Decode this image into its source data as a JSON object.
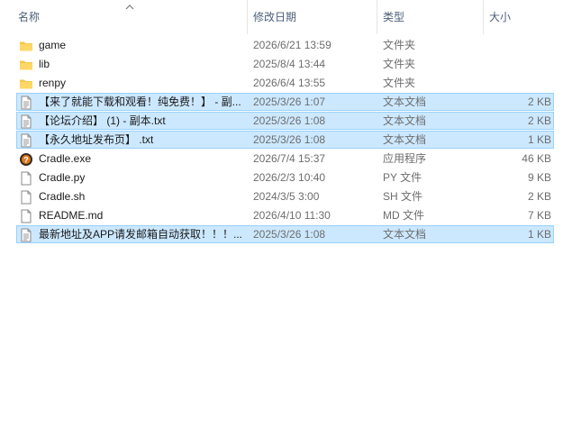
{
  "columns": {
    "name": "名称",
    "date": "修改日期",
    "type": "类型",
    "size": "大小"
  },
  "files": [
    {
      "name": "game",
      "date": "2026/6/21 13:59",
      "type": "文件夹",
      "size": "",
      "icon": "folder-icon",
      "selected": false
    },
    {
      "name": "lib",
      "date": "2025/8/4 13:44",
      "type": "文件夹",
      "size": "",
      "icon": "folder-icon",
      "selected": false
    },
    {
      "name": "renpy",
      "date": "2026/6/4 13:55",
      "type": "文件夹",
      "size": "",
      "icon": "folder-icon",
      "selected": false
    },
    {
      "name": "【来了就能下载和观看！纯免费！】 - 副...",
      "date": "2025/3/26 1:07",
      "type": "文本文档",
      "size": "2 KB",
      "icon": "text-document-icon",
      "selected": true
    },
    {
      "name": "【论坛介绍】 (1) - 副本.txt",
      "date": "2025/3/26 1:08",
      "type": "文本文档",
      "size": "2 KB",
      "icon": "text-document-icon",
      "selected": true
    },
    {
      "name": "【永久地址发布页】 .txt",
      "date": "2025/3/26 1:08",
      "type": "文本文档",
      "size": "1 KB",
      "icon": "text-document-icon",
      "selected": true
    },
    {
      "name": "Cradle.exe",
      "date": "2026/7/4 15:37",
      "type": "应用程序",
      "size": "46 KB",
      "icon": "application-icon",
      "selected": false
    },
    {
      "name": "Cradle.py",
      "date": "2026/2/3 10:40",
      "type": "PY 文件",
      "size": "9 KB",
      "icon": "file-icon",
      "selected": false
    },
    {
      "name": "Cradle.sh",
      "date": "2024/3/5 3:00",
      "type": "SH 文件",
      "size": "2 KB",
      "icon": "file-icon",
      "selected": false
    },
    {
      "name": "README.md",
      "date": "2026/4/10 11:30",
      "type": "MD 文件",
      "size": "7 KB",
      "icon": "file-icon",
      "selected": false
    },
    {
      "name": "最新地址及APP请发邮箱自动获取！！！...",
      "date": "2025/3/26 1:08",
      "type": "文本文档",
      "size": "1 KB",
      "icon": "text-document-icon",
      "selected": true
    }
  ],
  "colors": {
    "selection_bg": "#cce8ff",
    "selection_border": "#99d1ff",
    "folder": "#f5c84c",
    "header_text": "#4c607a"
  }
}
